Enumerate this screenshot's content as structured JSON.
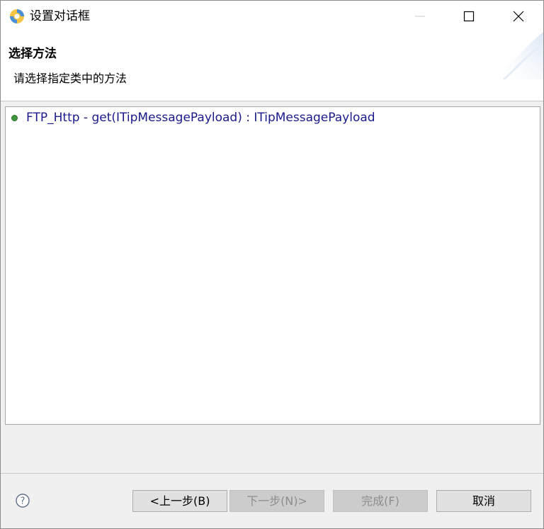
{
  "window": {
    "title": "设置对话框",
    "icon": "eclipse-app-icon",
    "controls": [
      "minimize-icon",
      "maximize-icon",
      "close-icon"
    ]
  },
  "banner": {
    "title": "选择方法",
    "description": "请选择指定类中的方法"
  },
  "methods": [
    {
      "label": "FTP_Http - get(ITipMessagePayload) : ITipMessagePayload",
      "icon": "public-method-icon",
      "icon_color": "#3f9a3f"
    }
  ],
  "footer": {
    "help_icon": "help-icon",
    "back_label": "<上一步(B)",
    "next_label": "下一步(N)>",
    "finish_label": "完成(F)",
    "cancel_label": "取消",
    "next_enabled": false,
    "finish_enabled": false
  },
  "colors": {
    "method_text": "#1a1a8c",
    "dialog_bg": "#f0f0f0",
    "button_bg": "#e1e1e1",
    "disabled_text": "#8d8d8d"
  }
}
